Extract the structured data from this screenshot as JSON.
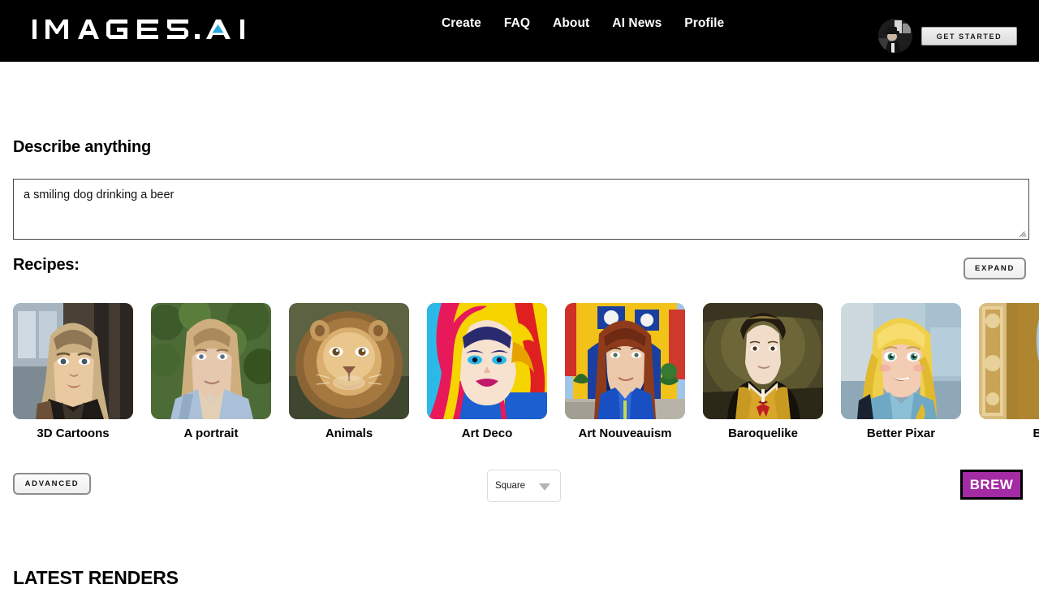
{
  "header": {
    "logo_text": "IMAGES.AI",
    "logo_accent_color": "#29a8e0",
    "nav": [
      {
        "label": "Create"
      },
      {
        "label": "FAQ"
      },
      {
        "label": "About"
      },
      {
        "label": "AI News"
      },
      {
        "label": "Profile"
      }
    ],
    "avatar_name": "user-avatar",
    "get_started_label": "GET STARTED",
    "background_color": "#000000"
  },
  "main": {
    "describe_title": "Describe anything",
    "prompt_value": "a smiling dog drinking a beer",
    "prompt_placeholder": "",
    "recipes_title": "Recipes:",
    "expand_label": "EXPAND",
    "recipes": [
      {
        "label": "3D Cartoons"
      },
      {
        "label": "A portrait"
      },
      {
        "label": "Animals"
      },
      {
        "label": "Art Deco"
      },
      {
        "label": "Art Nouveauism"
      },
      {
        "label": "Baroquelike"
      },
      {
        "label": "Better Pixar"
      },
      {
        "label": "Bi"
      }
    ]
  },
  "controls": {
    "advanced_label": "ADVANCED",
    "ratio_value": "Square",
    "ratio_options": [
      "Square"
    ],
    "brew_label": "BREW",
    "brew_color": "#a32ba3"
  },
  "footer": {
    "latest_renders_title": "LATEST RENDERS"
  }
}
